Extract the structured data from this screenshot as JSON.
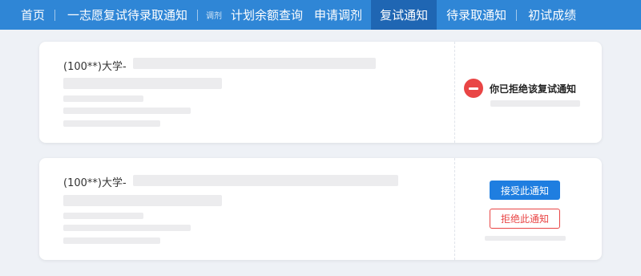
{
  "nav": {
    "items": [
      {
        "label": "首页"
      },
      {
        "label": "一志愿复试待录取通知"
      },
      {
        "label": "调剂"
      },
      {
        "label": "计划余额查询"
      },
      {
        "label": "申请调剂"
      },
      {
        "label": "复试通知"
      },
      {
        "label": "待录取通知"
      },
      {
        "label": "初试成绩"
      }
    ],
    "active": "复试通知"
  },
  "cards": [
    {
      "school": "(100**)大学-",
      "status_text": "你已拒绝该复试通知"
    },
    {
      "school": "(100**)大学-",
      "accept_label": "接受此通知",
      "reject_label": "拒绝此通知"
    }
  ],
  "colors": {
    "nav_bg": "#2f86d6",
    "nav_active": "#1f66b3",
    "accept": "#1f7ee0",
    "reject": "#e94545"
  }
}
